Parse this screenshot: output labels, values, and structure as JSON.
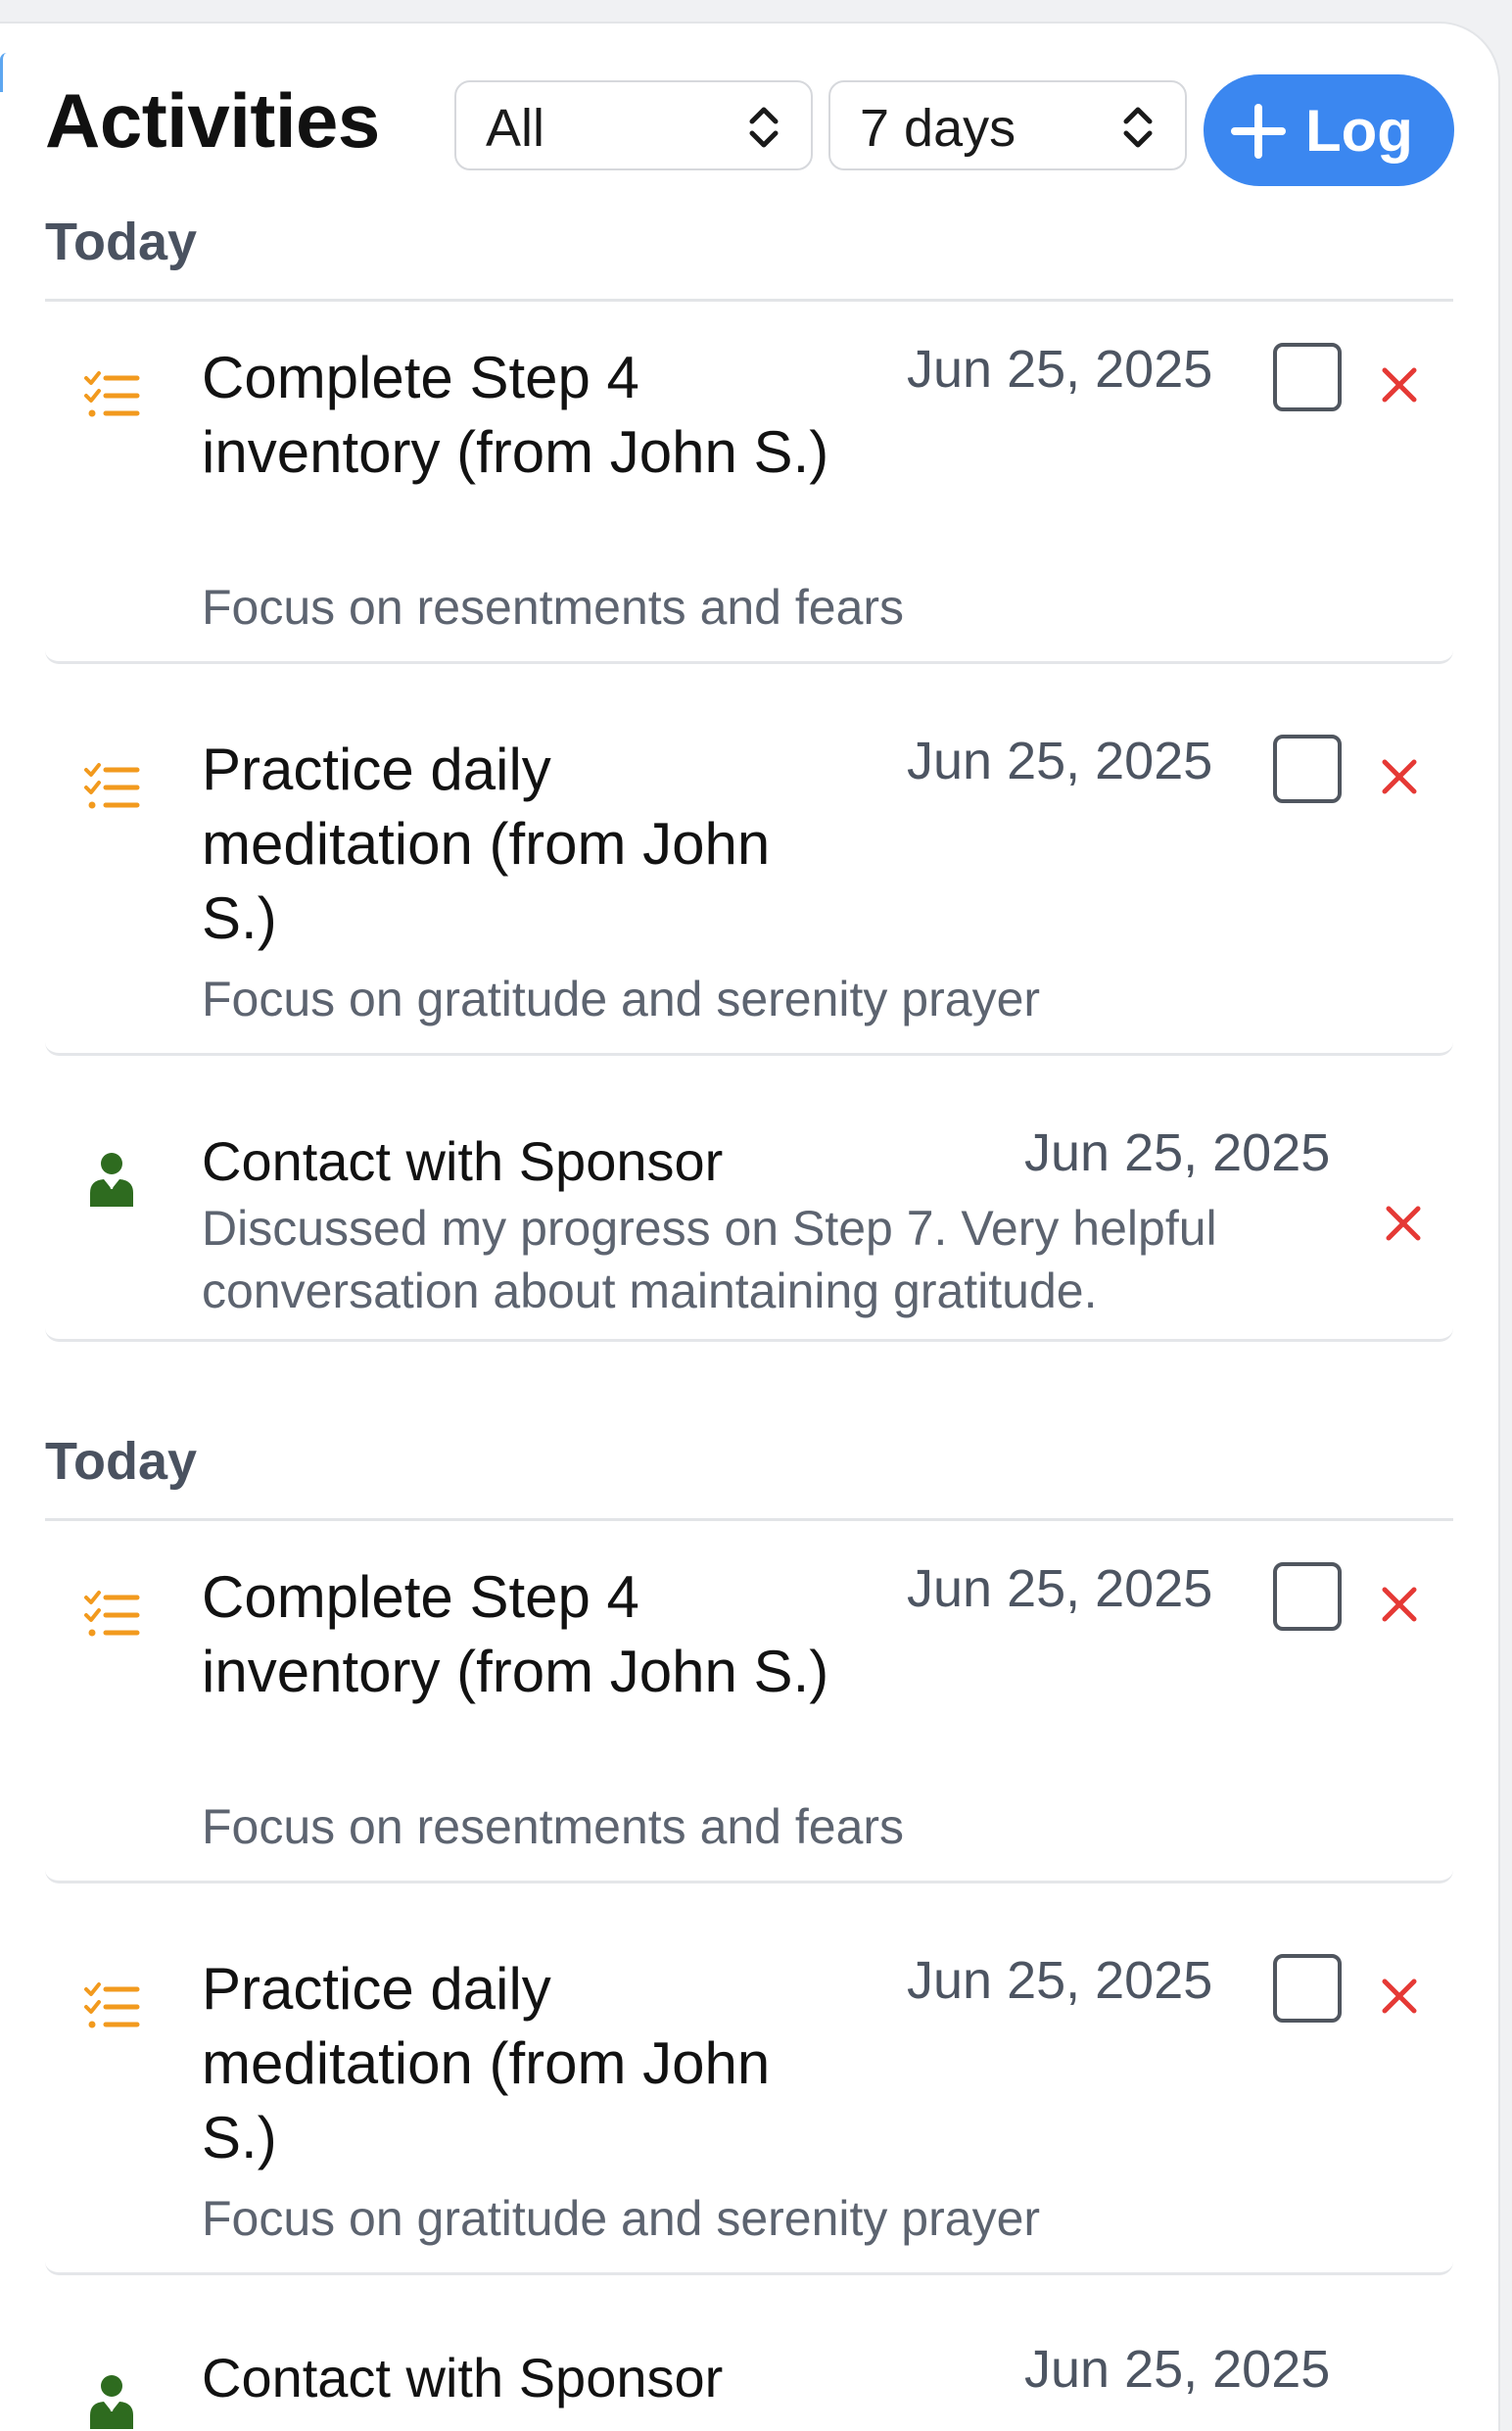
{
  "header": {
    "title": "Activities",
    "type_filter": "All",
    "range_filter": "7 days",
    "log_button_label": "Log"
  },
  "colors": {
    "accent": "#3b87f0",
    "action_item_icon": "#f29a1e",
    "sponsor_icon": "#2e6b1f",
    "delete": "#e53935"
  },
  "sections": [
    {
      "label": "Today",
      "items": [
        {
          "kind": "action-item",
          "icon": "checklist-icon",
          "title": "Complete Step 4 inventory (from John S.)",
          "date": "Jun 25, 2025",
          "description": "Focus on resentments and fears",
          "completed": false
        },
        {
          "kind": "action-item",
          "icon": "checklist-icon",
          "title": "Practice daily meditation (from John S.)",
          "date": "Jun 25, 2025",
          "description": "Focus on gratitude and serenity prayer",
          "completed": false
        },
        {
          "kind": "sponsor-contact",
          "icon": "sponsor-person-icon",
          "title": "Contact with Sponsor",
          "date": "Jun 25, 2025",
          "description": "Discussed my progress on Step 7. Very helpful conversation about maintaining gratitude."
        }
      ]
    },
    {
      "label": "Today",
      "items": [
        {
          "kind": "action-item",
          "icon": "checklist-icon",
          "title": "Complete Step 4 inventory (from John S.)",
          "date": "Jun 25, 2025",
          "description": "Focus on resentments and fears",
          "completed": false
        },
        {
          "kind": "action-item",
          "icon": "checklist-icon",
          "title": "Practice daily meditation (from John S.)",
          "date": "Jun 25, 2025",
          "description": "Focus on gratitude and serenity prayer",
          "completed": false
        },
        {
          "kind": "sponsor-contact",
          "icon": "sponsor-person-icon",
          "title": "Contact with Sponsor",
          "date": "Jun 25, 2025"
        }
      ]
    }
  ]
}
